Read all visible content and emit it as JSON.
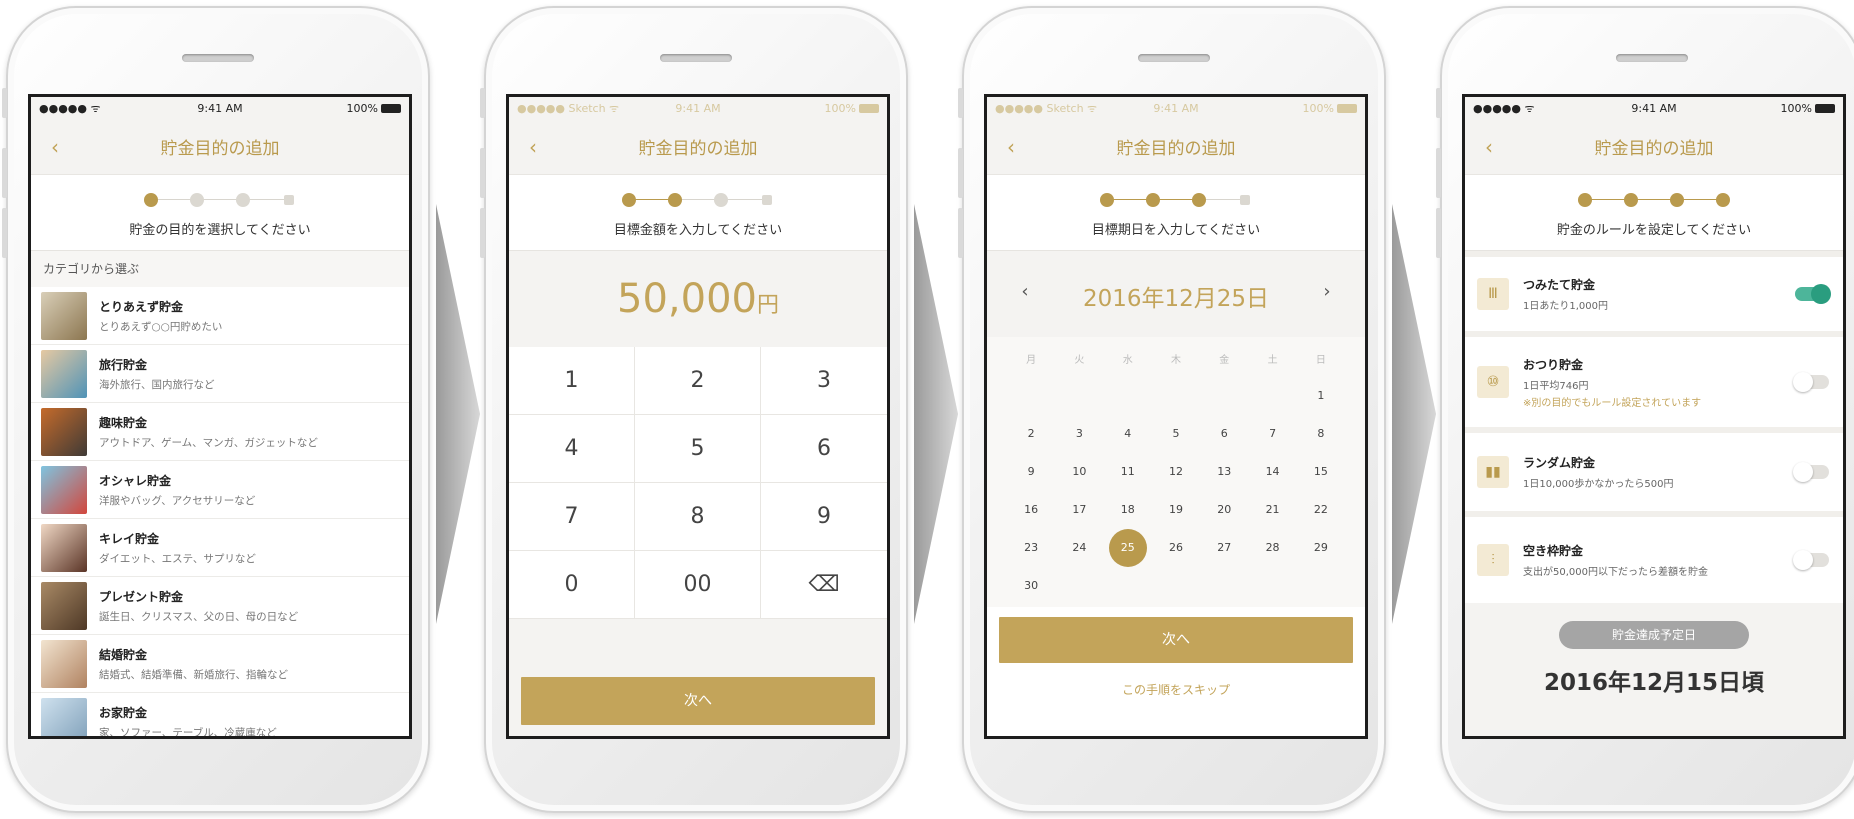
{
  "status": {
    "carrier": "●●●●● ᯤ",
    "carrier_sketch": "●●●●● Sketch ᯤ",
    "time": "9:41 AM",
    "battery": "100%"
  },
  "nav": {
    "title": "貯金目的の追加",
    "back": "‹"
  },
  "screen1": {
    "step_label": "貯金の目的を選択してください",
    "section": "カテゴリから選ぶ",
    "items": [
      {
        "title": "とりあえず貯金",
        "desc": "とりあえず○○円貯めたい",
        "color": "#b8a27a"
      },
      {
        "title": "旅行貯金",
        "desc": "海外旅行、国内旅行など",
        "color": "#6aa7c4"
      },
      {
        "title": "趣味貯金",
        "desc": "アウトドア、ゲーム、マンガ、ガジェットなど",
        "color": "#7a5a3a"
      },
      {
        "title": "オシャレ貯金",
        "desc": "洋服やバッグ、アクセサリーなど",
        "color": "#d2463c"
      },
      {
        "title": "キレイ貯金",
        "desc": "ダイエット、エステ、サプリなど",
        "color": "#8a5a45"
      },
      {
        "title": "プレゼント貯金",
        "desc": "誕生日、クリスマス、父の日、母の日など",
        "color": "#7b5a40"
      },
      {
        "title": "結婚貯金",
        "desc": "結婚式、結婚準備、新婚旅行、指輪など",
        "color": "#c9a987"
      },
      {
        "title": "お家貯金",
        "desc": "家、ソファー、テーブル、冷蔵庫など",
        "color": "#8fb0c9"
      }
    ]
  },
  "screen2": {
    "step_label": "目標金額を入力してください",
    "amount": "50,000",
    "yen": "円",
    "keys": [
      "1",
      "2",
      "3",
      "4",
      "5",
      "6",
      "7",
      "8",
      "9",
      "0",
      "00",
      "⌫"
    ],
    "next": "次へ"
  },
  "screen3": {
    "step_label": "目標期日を入力してください",
    "month": "2016年12月25日",
    "prev": "‹",
    "next_arrow": "›",
    "weekdays": [
      "月",
      "火",
      "水",
      "木",
      "金",
      "土",
      "日"
    ],
    "days": [
      "",
      "",
      "",
      "",
      "",
      "",
      "1",
      "2",
      "3",
      "4",
      "5",
      "6",
      "7",
      "8",
      "9",
      "10",
      "11",
      "12",
      "13",
      "14",
      "15",
      "16",
      "17",
      "18",
      "19",
      "20",
      "21",
      "22",
      "23",
      "24",
      "25",
      "26",
      "27",
      "28",
      "29",
      "30"
    ],
    "selected": "25",
    "next": "次へ",
    "skip": "この手順をスキップ"
  },
  "screen4": {
    "step_label": "貯金のルールを設定してください",
    "rules": [
      {
        "title": "つみたて貯金",
        "desc": "1日あたり1,000円",
        "note": "",
        "icon": "Ⅲ",
        "on": true
      },
      {
        "title": "おつり貯金",
        "desc": "1日平均746円",
        "note": "※別の目的でもルール設定されています",
        "icon": "⑩",
        "on": false
      },
      {
        "title": "ランダム貯金",
        "desc": "1日10,000歩かなかったら500円",
        "note": "",
        "icon": "▮▮",
        "on": false
      },
      {
        "title": "空き枠貯金",
        "desc": "支出が50,000円以下だったら差額を貯金",
        "note": "",
        "icon": "⫶",
        "on": false
      }
    ],
    "goal_label": "貯金達成予定日",
    "goal_date": "2016年12月15日頃"
  },
  "colors": {
    "gold": "#c3a45a",
    "toggle_on": "#2a9d7f"
  }
}
